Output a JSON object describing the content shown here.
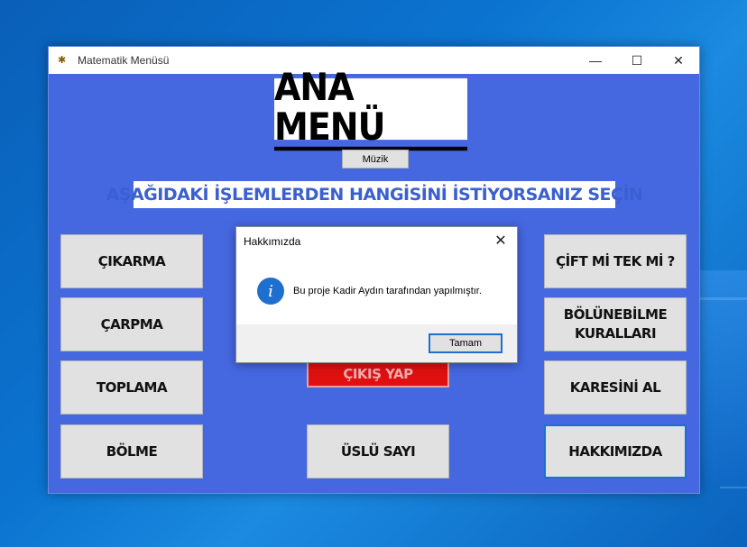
{
  "window": {
    "title": "Matematik Menüsü",
    "controls": {
      "minimize": "—",
      "maximize": "☐",
      "close": "✕"
    }
  },
  "header": {
    "title": "ANA MENÜ",
    "music_button": "Müzik",
    "subtitle": "AŞAĞIDAKİ İŞLEMLERDEN HANGİSİNİ İSTİYORSANIZ SEÇİN"
  },
  "left_buttons": [
    "ÇIKARMA",
    "ÇARPMA",
    "TOPLAMA",
    "BÖLME"
  ],
  "right_buttons": [
    "ÇİFT Mİ TEK Mİ ?",
    "BÖLÜNEBİLME KURALLARI",
    "KARESİNİ AL",
    "HAKKIMIZDA"
  ],
  "center_buttons": {
    "exit": "ÇIKIŞ YAP",
    "exponent": "ÜSLÜ SAYI"
  },
  "dialog": {
    "title": "Hakkımızda",
    "message": "Bu proje Kadir Aydın tarafından yapılmıştır.",
    "ok": "Tamam",
    "close": "✕",
    "icon": "info-icon"
  },
  "colors": {
    "window_bg": "#4567e0",
    "exit_button": "#e01010",
    "accent": "#1f6fd0"
  }
}
